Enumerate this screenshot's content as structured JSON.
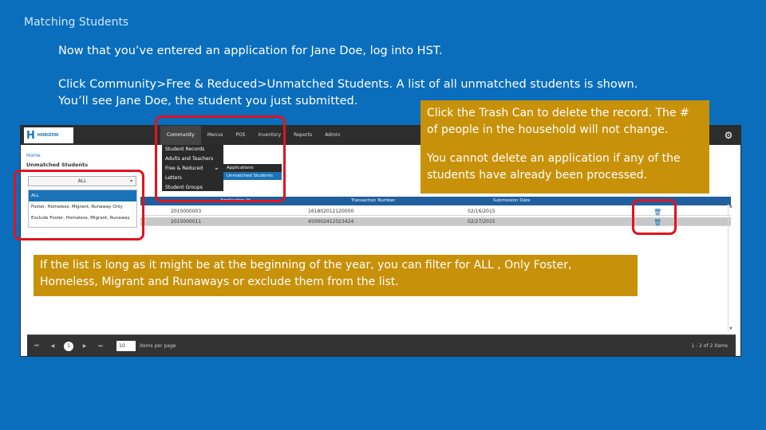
{
  "slide": {
    "title": "Matching Students",
    "para1": "Now that you’ve entered an application for Jane Doe, log into HST.",
    "para2": "Click Community>Free & Reduced>Unmatched Students. A list of all unmatched students is shown. You’ll see Jane Doe, the student you just submitted.",
    "callout_trash_1": "Click the Trash Can to delete the record. The # of people in the household will not change.",
    "callout_trash_2": "You cannot delete an application if any of the students have already been processed.",
    "callout_filter": "If the list is long as it might be at the beginning of the year, you can filter for ALL , Only Foster, Homeless, Migrant and Runaways or exclude them from the list."
  },
  "app": {
    "logo_text": "HORIZON",
    "menu": [
      "Community",
      "Menus",
      "POS",
      "Inventory",
      "Reports",
      "Admin"
    ],
    "community_dropdown": [
      "Student Records",
      "Adults and Teachers",
      "Free & Reduced",
      "Letters",
      "Student Groups"
    ],
    "fr_submenu": [
      "Applications",
      "Unmatched Students"
    ],
    "breadcrumb": "Home",
    "page_title": "Unmatched Students",
    "filter_value": "ALL",
    "filter_options": [
      "ALL",
      "Foster, Homeless, Migrant, Runaway Only",
      "Exclude Foster, Homeless, Migrant, Runaway"
    ],
    "columns": [
      "Application Id",
      "Transaction Number",
      "Submission Date"
    ],
    "rows": [
      {
        "app_id": "2015000003",
        "txn": "161802012120000",
        "date": "02/16/2015"
      },
      {
        "app_id": "2015000011",
        "txn": "450002412023424",
        "date": "02/27/2015"
      }
    ],
    "pager": {
      "current": "1",
      "page_size": "10",
      "items_per_page": "items per page",
      "count": "1 - 2 of 2 items"
    }
  }
}
